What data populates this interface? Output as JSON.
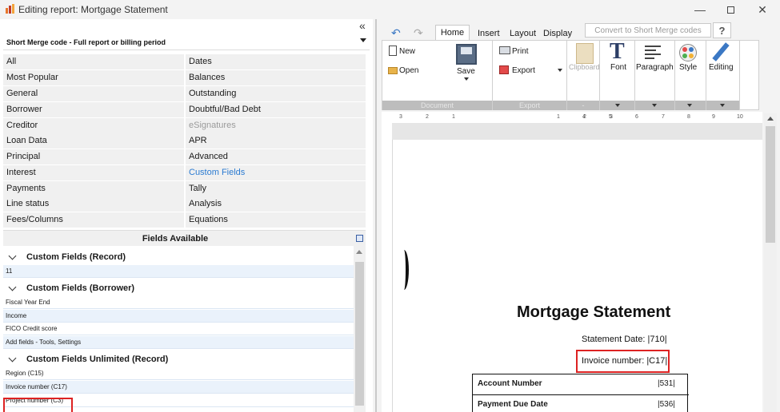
{
  "window": {
    "title": "Editing report: Mortgage Statement"
  },
  "left": {
    "dropdown_label": "Short Merge code - Full report or billing period",
    "categories_col1": [
      "All",
      "Most Popular",
      "General",
      "Borrower",
      "Creditor",
      "Loan Data",
      "Principal",
      "Interest",
      "Payments",
      "Line status",
      "Fees/Columns"
    ],
    "categories_col2": [
      "Dates",
      "Balances",
      "Outstanding",
      "Doubtful/Bad Debt",
      "eSignatures",
      "APR",
      "Advanced",
      "Custom Fields",
      "Tally",
      "Analysis",
      "Equations"
    ],
    "fields_title": "Fields Available",
    "groups": [
      {
        "label": "Custom Fields (Record)",
        "items": [
          "11"
        ]
      },
      {
        "label": "Custom Fields (Borrower)",
        "items": [
          "Fiscal Year End",
          "Income",
          "FICO Credit score",
          "Add fields - Tools, Settings"
        ]
      },
      {
        "label": "Custom Fields Unlimited  (Record)",
        "items": [
          "Region (C15)",
          "Invoice number (C17)",
          "Project number (C3)"
        ]
      }
    ]
  },
  "ribbon": {
    "tabs": [
      "Home",
      "Insert",
      "Layout",
      "Display"
    ],
    "convert_label": "Convert to Short Merge codes",
    "help_label": "?",
    "new_label": "New",
    "open_label": "Open",
    "save_label": "Save",
    "print_label": "Print",
    "export_label": "Export",
    "clipboard_label": "Clipboard",
    "font_label": "Font",
    "paragraph_label": "Paragraph",
    "style_label": "Style",
    "editing_label": "Editing",
    "group_document": "Document",
    "group_export": "Export",
    "group_dash": "-"
  },
  "ruler": {
    "ticks": [
      "3",
      "2",
      "1",
      "1",
      "2",
      "3",
      "4",
      "5",
      "6",
      "7",
      "8",
      "9",
      "10"
    ]
  },
  "document": {
    "title": "Mortgage Statement",
    "statement_date": "Statement Date: |710|",
    "invoice_number": "Invoice number: |C17|",
    "rows": [
      {
        "label": "Account Number",
        "value": "|531|"
      },
      {
        "label": "Payment Due Date",
        "value": "|536|"
      }
    ]
  }
}
